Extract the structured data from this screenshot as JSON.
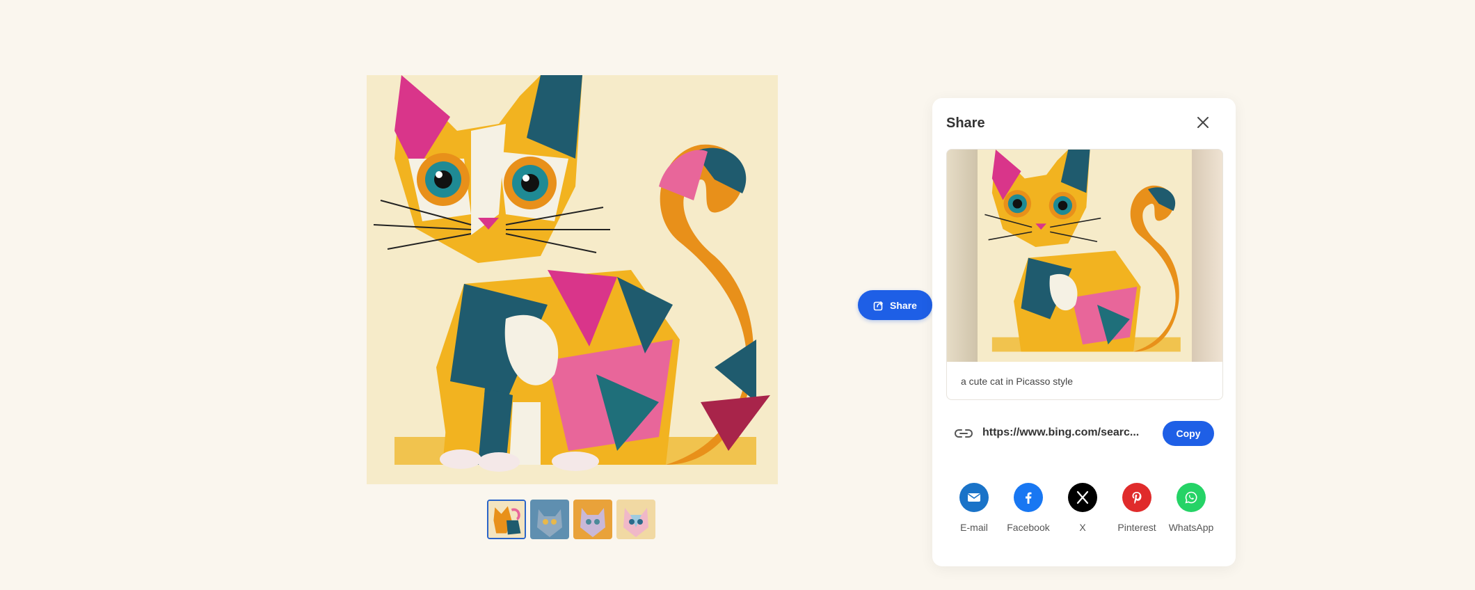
{
  "image": {
    "subject": "a cute cat in Picasso style",
    "thumbnails": [
      {
        "name": "thumb-1",
        "active": true
      },
      {
        "name": "thumb-2",
        "active": false
      },
      {
        "name": "thumb-3",
        "active": false
      },
      {
        "name": "thumb-4",
        "active": false
      }
    ]
  },
  "share_pill": {
    "label": "Share",
    "icon": "share-icon"
  },
  "panel": {
    "title": "Share",
    "close_icon": "close-icon",
    "preview_caption": "a cute cat in Picasso style",
    "link": {
      "text": "https://www.bing.com/searc...",
      "icon": "link-icon"
    },
    "copy_label": "Copy",
    "socials": [
      {
        "label": "E-mail",
        "icon": "email-icon",
        "color": "#1a73c8"
      },
      {
        "label": "Facebook",
        "icon": "facebook-icon",
        "color": "#1877f2"
      },
      {
        "label": "X",
        "icon": "x-icon",
        "color": "#000000"
      },
      {
        "label": "Pinterest",
        "icon": "pinterest-icon",
        "color": "#e02b2b"
      },
      {
        "label": "WhatsApp",
        "icon": "whatsapp-icon",
        "color": "#25d366"
      }
    ]
  },
  "colors": {
    "accent": "#1e5fe6",
    "background": "#faf6ee"
  }
}
